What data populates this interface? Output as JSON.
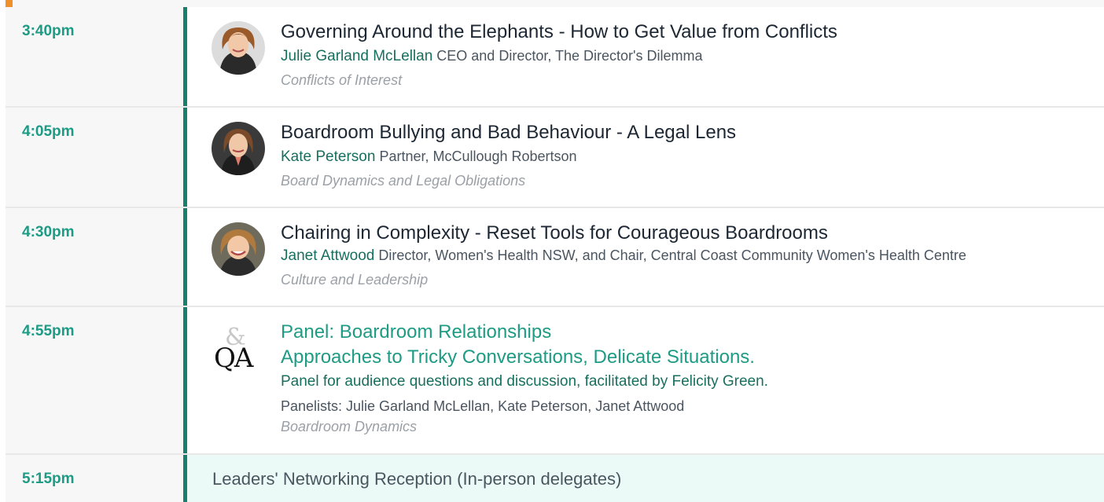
{
  "sessions": [
    {
      "time": "3:40pm",
      "title": "Governing Around the Elephants - How to Get Value from Conflicts",
      "speaker_name": "Julie Garland McLellan",
      "speaker_role": "CEO and Director, The Director's Dilemma",
      "track": "Conflicts of Interest",
      "avatar_icon": "speaker-photo-julie"
    },
    {
      "time": "4:05pm",
      "title": "Boardroom Bullying and Bad Behaviour - A Legal Lens",
      "speaker_name": "Kate Peterson",
      "speaker_role": "Partner, McCullough Robertson",
      "track": "Board Dynamics and Legal Obligations",
      "avatar_icon": "speaker-photo-kate"
    },
    {
      "time": "4:30pm",
      "title": "Chairing in Complexity - Reset Tools for Courageous Boardrooms",
      "speaker_name": "Janet Attwood",
      "speaker_role": "Director, Women's Health NSW, and Chair, Central Coast Community Women's Health Centre",
      "track": "Culture and Leadership",
      "avatar_icon": "speaker-photo-janet"
    }
  ],
  "panel": {
    "time": "4:55pm",
    "icon": "qa-icon",
    "icon_text": {
      "amp": "&",
      "qa": "QA"
    },
    "title_line1": "Panel: Boardroom Relationships",
    "title_line2": "Approaches to Tricky Conversations, Delicate Situations.",
    "description": "Panel for audience questions and discussion, facilitated by Felicity Green.",
    "panelists": "Panelists: Julie Garland McLellan, Kate Peterson, Janet Attwood",
    "track": "Boardroom Dynamics"
  },
  "reception": {
    "time": "5:15pm",
    "title": "Leaders' Networking Reception (In-person delegates)"
  },
  "colors": {
    "time_text": "#1e9b84",
    "accent_bar": "#17806d",
    "speaker_name": "#176f5e",
    "reception_bg": "#ebfaf7",
    "top_accent": "#f0902a"
  }
}
